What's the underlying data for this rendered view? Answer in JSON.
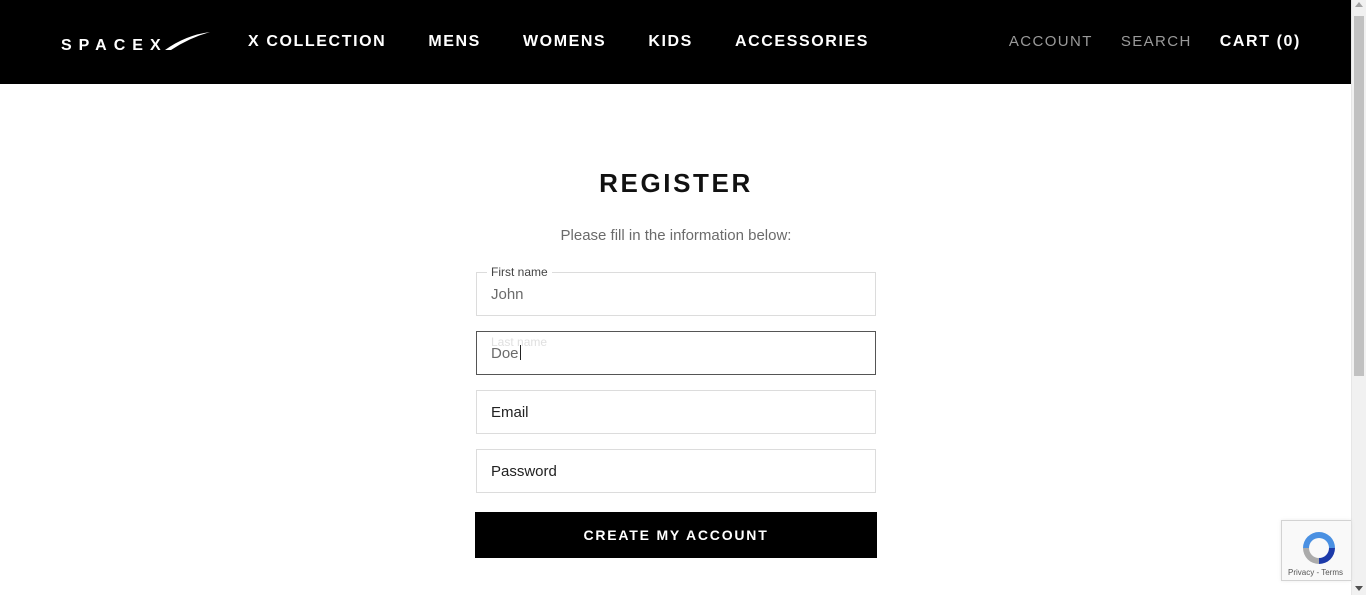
{
  "header": {
    "logo_text": "SPACEX",
    "nav": [
      "X COLLECTION",
      "MENS",
      "WOMENS",
      "KIDS",
      "ACCESSORIES"
    ],
    "account_label": "ACCOUNT",
    "search_label": "SEARCH",
    "cart_label": "CART (0)"
  },
  "form": {
    "title": "REGISTER",
    "subtitle": "Please fill in the information below:",
    "first_name": {
      "label": "First name",
      "value": "John"
    },
    "last_name": {
      "label": "Last name",
      "value": "Doe"
    },
    "email": {
      "placeholder": "Email"
    },
    "password": {
      "placeholder": "Password"
    },
    "submit_label": "CREATE MY ACCOUNT"
  },
  "recaptcha": {
    "privacy": "Privacy",
    "separator": " - ",
    "terms": "Terms"
  },
  "colors": {
    "header_bg": "#000000",
    "button_bg": "#000000",
    "accent": "#ffffff"
  }
}
